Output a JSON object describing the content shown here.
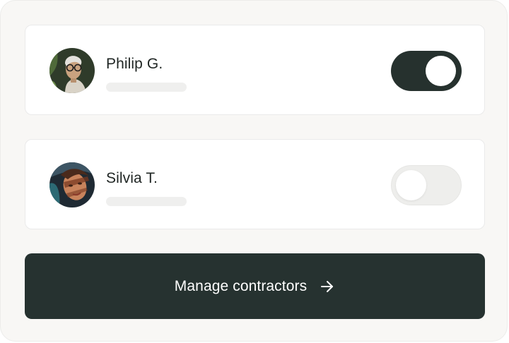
{
  "contractors": [
    {
      "name": "Philip G.",
      "enabled": true,
      "avatar_icon": "person-with-glasses-avatar"
    },
    {
      "name": "Silvia T.",
      "enabled": false,
      "avatar_icon": "person-portrait-avatar"
    }
  ],
  "cta": {
    "label": "Manage contractors",
    "icon": "arrow-right-icon"
  },
  "colors": {
    "accent_dark": "#263230",
    "toggle_on": "#26312e",
    "toggle_off": "#eeeeec",
    "panel_bg": "#f8f7f5",
    "card_bg": "#ffffff",
    "text": "#1f2523"
  }
}
